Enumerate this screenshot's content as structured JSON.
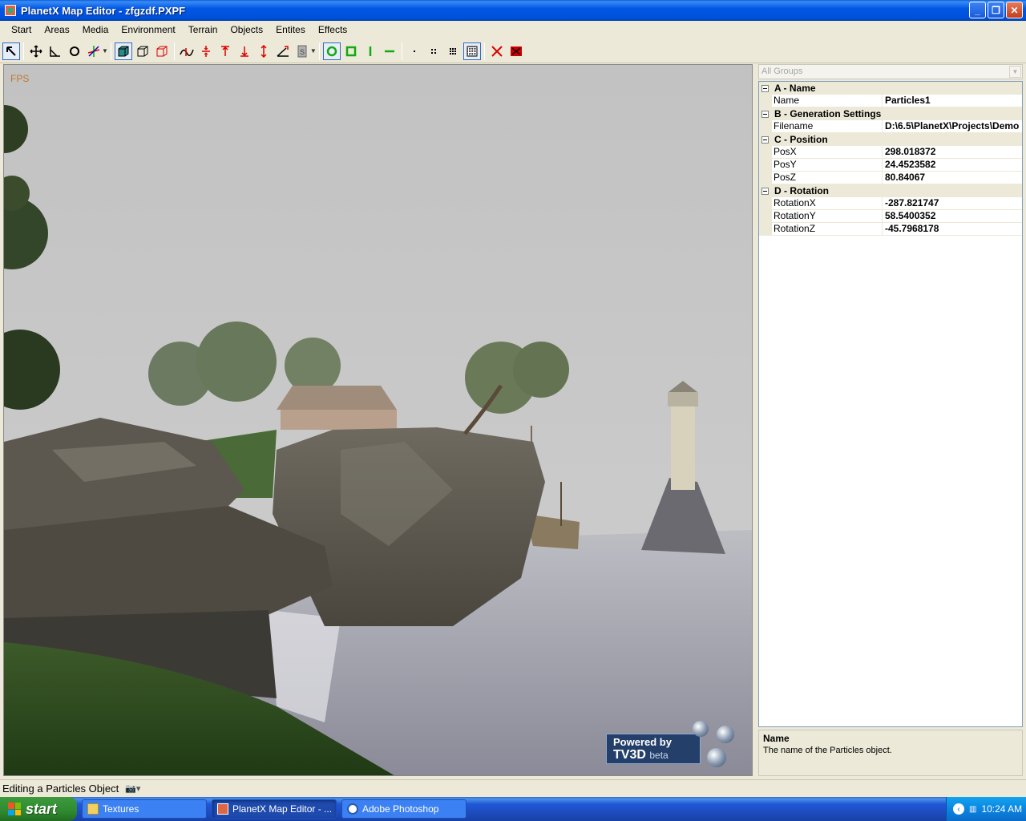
{
  "window": {
    "title": "PlanetX Map Editor - zfgzdf.PXPF",
    "icon": "app-icon"
  },
  "menu": [
    "Start",
    "Areas",
    "Media",
    "Environment",
    "Terrain",
    "Objects",
    "Entites",
    "Effects"
  ],
  "toolbar": {
    "tools": [
      "select-arrow-icon",
      "move-icon",
      "scale-icon",
      "rotate-icon",
      "axis-icon",
      "solid-box-icon",
      "wire-box-icon",
      "wire-red-box-icon",
      "terrain-smooth-icon",
      "terrain-flatten-icon",
      "terrain-raise-icon",
      "terrain-lower-icon",
      "terrain-updown-icon",
      "terrain-slope-icon",
      "paint-icon",
      "circle-brush-icon",
      "square-brush-icon",
      "vertical-line-icon",
      "horizontal-line-icon",
      "brush-size-1-icon",
      "brush-size-2-icon",
      "brush-size-3-icon",
      "brush-size-4-icon",
      "delete-x-icon",
      "delete-all-icon"
    ]
  },
  "viewport": {
    "fps": "FPS",
    "powered_by": "Powered by",
    "engine": "TV3D",
    "engine_tag": "beta"
  },
  "properties": {
    "groups_filter": "All Groups",
    "categories": [
      {
        "label": "A - Name",
        "rows": [
          {
            "key": "Name",
            "value": "Particles1"
          }
        ]
      },
      {
        "label": "B - Generation Settings",
        "rows": [
          {
            "key": "Filename",
            "value": "D:\\6.5\\PlanetX\\Projects\\Demo"
          }
        ]
      },
      {
        "label": "C - Position",
        "rows": [
          {
            "key": "PosX",
            "value": "298.018372"
          },
          {
            "key": "PosY",
            "value": "24.4523582"
          },
          {
            "key": "PosZ",
            "value": "80.84067"
          }
        ]
      },
      {
        "label": "D - Rotation",
        "rows": [
          {
            "key": "RotationX",
            "value": "-287.821747"
          },
          {
            "key": "RotationY",
            "value": "58.5400352"
          },
          {
            "key": "RotationZ",
            "value": "-45.7968178"
          }
        ]
      }
    ],
    "help_title": "Name",
    "help_text": "The name of the Particles object."
  },
  "status": {
    "text": "Editing a Particles Object"
  },
  "taskbar": {
    "start": "start",
    "tasks": [
      {
        "label": "Textures",
        "active": false
      },
      {
        "label": "PlanetX Map Editor - ...",
        "active": true
      },
      {
        "label": "Adobe Photoshop",
        "active": false
      }
    ],
    "clock": "10:24 AM"
  }
}
